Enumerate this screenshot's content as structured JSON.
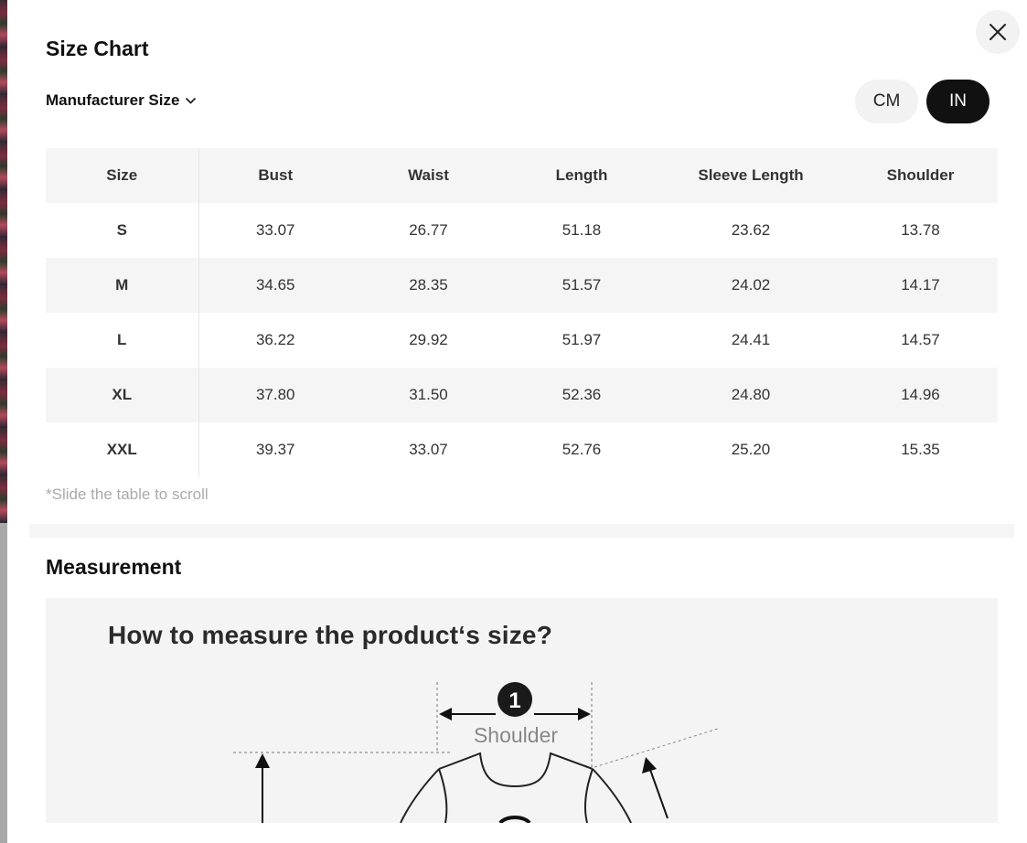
{
  "modal": {
    "title": "Size Chart",
    "size_selector": {
      "label": "Manufacturer Size",
      "icon": "chevron-down-icon"
    },
    "close_icon": "close-icon",
    "units": [
      {
        "label": "CM",
        "selected": false
      },
      {
        "label": "IN",
        "selected": true
      }
    ],
    "colors": {
      "selected_unit_bg": "#111111",
      "unselected_unit_bg": "#f2f2f2",
      "stripe": "#f5f5f5"
    }
  },
  "table": {
    "headers": [
      "Size",
      "Bust",
      "Waist",
      "Length",
      "Sleeve Length",
      "Shoulder"
    ],
    "rows": [
      [
        "S",
        "33.07",
        "26.77",
        "51.18",
        "23.62",
        "13.78"
      ],
      [
        "M",
        "34.65",
        "28.35",
        "51.57",
        "24.02",
        "14.17"
      ],
      [
        "L",
        "36.22",
        "29.92",
        "51.97",
        "24.41",
        "14.57"
      ],
      [
        "XL",
        "37.80",
        "31.50",
        "52.36",
        "24.80",
        "14.96"
      ],
      [
        "XXL",
        "39.37",
        "33.07",
        "52.76",
        "25.20",
        "15.35"
      ]
    ],
    "hint": "*Slide the table to scroll"
  },
  "measurement": {
    "title": "Measurement",
    "image": {
      "heading": "How to measure the product‘s size?",
      "marker_number": "1",
      "marker_label": "Shoulder"
    }
  }
}
